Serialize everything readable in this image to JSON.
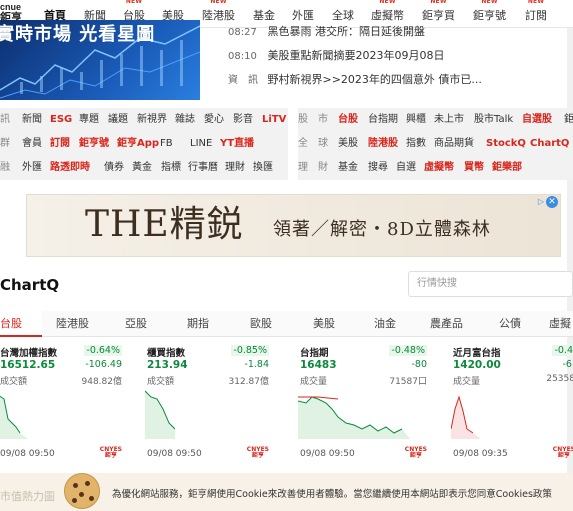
{
  "logo": {
    "line1": "cnue",
    "line2": "鉅亨"
  },
  "nav": [
    {
      "label": "首頁",
      "new": false,
      "active": true
    },
    {
      "label": "新聞",
      "new": false
    },
    {
      "label": "台股",
      "new": true
    },
    {
      "label": "美股",
      "new": false
    },
    {
      "label": "陸港股",
      "new": true
    },
    {
      "label": "基金",
      "new": false
    },
    {
      "label": "外匯",
      "new": false
    },
    {
      "label": "全球",
      "new": false
    },
    {
      "label": "虛擬幣",
      "new": true
    },
    {
      "label": "鉅亨買",
      "new": true
    },
    {
      "label": "鉅亨號",
      "new": true
    },
    {
      "label": "訂閱",
      "new": true
    }
  ],
  "new_badge": "NEW",
  "hero": {
    "title": "實時市場 光看星圖"
  },
  "news": [
    {
      "time": "08:27",
      "headline": "黑色暴雨 港交所：隔日延後開盤"
    },
    {
      "time": "08:10",
      "headline": "美股重點新聞摘要2023年09月08日"
    },
    {
      "time": "資　訊",
      "headline": "野村新視界>>2023年的四個意外 債市已..."
    }
  ],
  "links": {
    "row1_left": {
      "cat": "訊",
      "items": [
        "新聞",
        "ESG",
        "專題",
        "議題",
        "新視界",
        "雜誌",
        "愛心",
        "影音",
        "LiTV"
      ],
      "hl": [
        "ESG",
        "LiTV"
      ]
    },
    "row2_left": {
      "cat": "群",
      "items": [
        "會員",
        "訂閱",
        "鉅亨號",
        "鉅亨App",
        "FB",
        "LINE",
        "YT直播"
      ],
      "hl": [
        "訂閱",
        "鉅亨號",
        "鉅亨App",
        "YT直播"
      ]
    },
    "row3_left": {
      "cat": "融",
      "items": [
        "外匯",
        "路透即時",
        "債券",
        "黃金",
        "指標",
        "行事曆",
        "理財",
        "換匯"
      ],
      "hl": [
        "路透即時"
      ]
    },
    "row1_right": {
      "cat": "股　市",
      "items": [
        "台股",
        "台指期",
        "興櫃",
        "未上市",
        "股市Talk",
        "自選股",
        "鉅"
      ],
      "hl": [
        "台股",
        "自選股"
      ]
    },
    "row2_right": {
      "cat": "全　球",
      "items": [
        "美股",
        "陸港股",
        "指數",
        "商品期貨",
        "StockQ",
        "ChartQ"
      ],
      "hl": [
        "陸港股",
        "StockQ",
        "ChartQ"
      ]
    },
    "row3_right": {
      "cat": "理　財",
      "items": [
        "基金",
        "搜尋",
        "自選",
        "虛擬幣",
        "買幣",
        "鉅樂部"
      ],
      "hl": [
        "虛擬幣",
        "買幣",
        "鉅樂部"
      ]
    }
  },
  "ad": {
    "brand": "THE精鋭",
    "sub": "領著／解密・8D立體森林",
    "close": "✕"
  },
  "chartq": {
    "title": "ChartQ",
    "search_placeholder": "行情快搜"
  },
  "tabs": [
    "台股",
    "陸港股",
    "亞股",
    "期指",
    "歐股",
    "美股",
    "油金",
    "農產品",
    "公債",
    "虛擬"
  ],
  "quotes": [
    {
      "name": "台灣加權指數",
      "pct": "-0.64%",
      "price": "16512.65",
      "chg": "-106.49",
      "vol_label": "成交額",
      "vol": "948.82億",
      "time": "09/08 09:50"
    },
    {
      "name": "櫃買指數",
      "pct": "-0.85%",
      "price": "213.94",
      "chg": "-1.84",
      "vol_label": "成交額",
      "vol": "312.87億",
      "time": "09/08 09:50"
    },
    {
      "name": "台指期",
      "pct": "-0.48%",
      "price": "16483",
      "chg": "-80",
      "vol_label": "成交量",
      "vol": "71587口",
      "time": "09/08 09:50"
    },
    {
      "name": "近月富台指",
      "pct": "-0.4",
      "price": "1420.00",
      "chg": "-6.",
      "vol_label": "成交量",
      "vol": "25358",
      "time": "09/08 09:35"
    }
  ],
  "chart_brand": {
    "line1": "CNYES",
    "line2": "鉅亨"
  },
  "cookie": {
    "text": "為優化網站服務，鉅亨網使用Cookie來改善使用者體驗。當您繼續使用本網站即表示您同意Cookies政策",
    "faded": "市值熱力圖"
  },
  "colors": {
    "down": "#0a8a3a",
    "accent": "#d9261c"
  }
}
